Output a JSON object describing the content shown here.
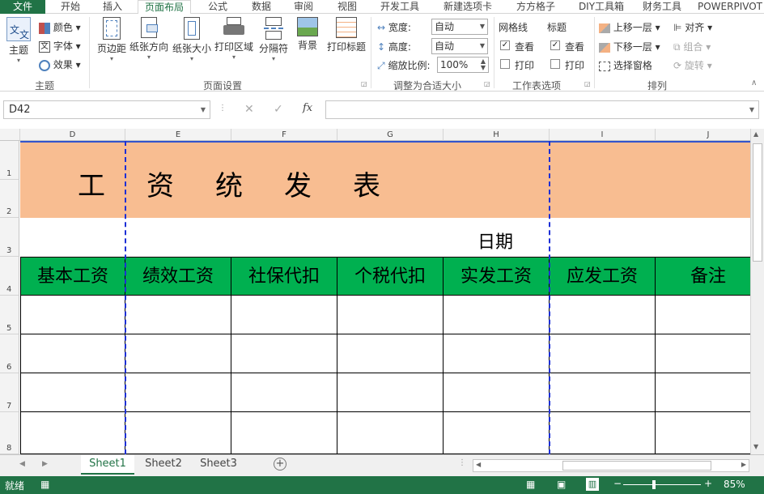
{
  "ribbon_tabs": [
    "文件",
    "开始",
    "插入",
    "页面布局",
    "公式",
    "数据",
    "审阅",
    "视图",
    "开发工具",
    "新建选项卡",
    "方方格子",
    "DIY工具箱",
    "财务工具",
    "POWERPIVOT"
  ],
  "themes_group": {
    "label": "主题",
    "big": "主题",
    "colors": "颜色",
    "fonts": "字体",
    "effects": "效果"
  },
  "page_setup": {
    "label": "页面设置",
    "buttons": [
      "页边距",
      "纸张方向",
      "纸张大小",
      "打印区域",
      "分隔符",
      "背景",
      "打印标题"
    ]
  },
  "scale_fit": {
    "label": "调整为合适大小",
    "width_label": "宽度:",
    "width_value": "自动",
    "height_label": "高度:",
    "height_value": "自动",
    "scale_label": "缩放比例:",
    "scale_value": "100%"
  },
  "sheet_options": {
    "label": "工作表选项",
    "gridlines": "网格线",
    "headings": "标题",
    "view": "查看",
    "print": "打印"
  },
  "arrange": {
    "label": "排列",
    "bring_forward": "上移一层",
    "send_backward": "下移一层",
    "selection_pane": "选择窗格",
    "align": "对齐",
    "group": "组合",
    "rotate": "旋转"
  },
  "formula_bar": {
    "name_box": "D42",
    "formula": ""
  },
  "columns": [
    "D",
    "E",
    "F",
    "G",
    "H",
    "I",
    "J"
  ],
  "rows": [
    "1",
    "2",
    "3",
    "4",
    "5",
    "6",
    "7",
    "8"
  ],
  "sheet": {
    "title_chars": [
      "工",
      "资",
      "统",
      "发",
      "表"
    ],
    "date_label": "日期",
    "headers": [
      "基本工资",
      "绩效工资",
      "社保代扣",
      "个税代扣",
      "实发工资",
      "应发工资",
      "备注"
    ]
  },
  "sheet_tabs": [
    "Sheet1",
    "Sheet2",
    "Sheet3"
  ],
  "status": {
    "ready": "就绪",
    "zoom": "85%"
  },
  "colors": {
    "title_fill": "#f8bd91",
    "header_fill": "#00b050",
    "excel_green": "#217346"
  }
}
